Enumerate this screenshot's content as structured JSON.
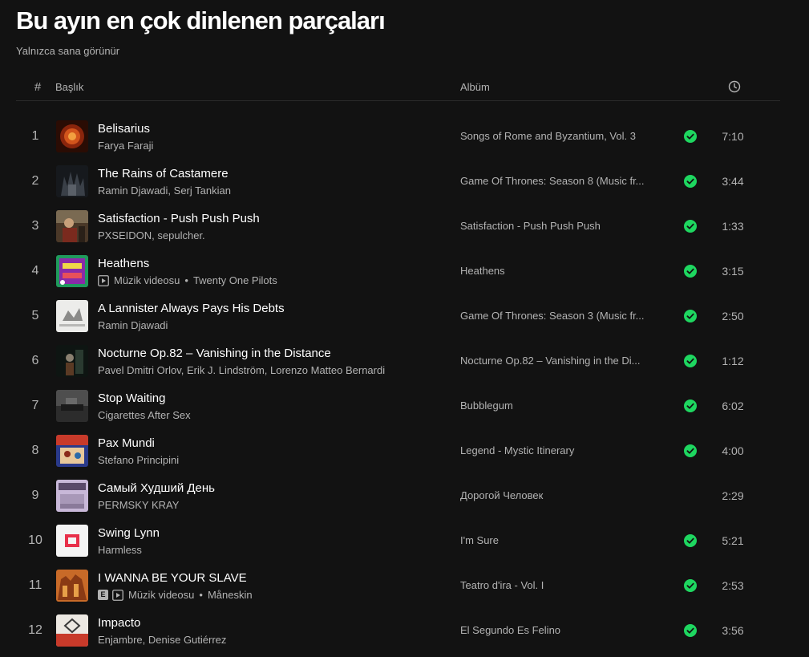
{
  "page": {
    "title": "Bu ayın en çok dinlenen parçaları",
    "subtitle": "Yalnızca sana görünür"
  },
  "header": {
    "num": "#",
    "title": "Başlık",
    "album": "Albüm",
    "duration_icon": "clock-icon"
  },
  "colors": {
    "accent": "#1ed760",
    "background": "#121212",
    "muted": "#b3b3b3"
  },
  "video_label": "Müzik videosu",
  "explicit_label": "E",
  "tracks": [
    {
      "num": "1",
      "title": "Belisarius",
      "artist": "Farya Faraji",
      "album": "Songs of Rome and Byzantium, Vol. 3",
      "duration": "7:10",
      "saved": true
    },
    {
      "num": "2",
      "title": "The Rains of Castamere",
      "artist": "Ramin Djawadi, Serj Tankian",
      "album": "Game Of Thrones: Season 8 (Music fr...",
      "duration": "3:44",
      "saved": true
    },
    {
      "num": "3",
      "title": "Satisfaction - Push Push Push",
      "artist": "PXSEIDON, sepulcher.",
      "album": "Satisfaction - Push Push Push",
      "duration": "1:33",
      "saved": true
    },
    {
      "num": "4",
      "title": "Heathens",
      "artist": "Twenty One Pilots",
      "album": "Heathens",
      "duration": "3:15",
      "saved": true,
      "video": true
    },
    {
      "num": "5",
      "title": "A Lannister Always Pays His Debts",
      "artist": "Ramin Djawadi",
      "album": "Game Of Thrones: Season 3 (Music fr...",
      "duration": "2:50",
      "saved": true
    },
    {
      "num": "6",
      "title": "Nocturne Op.82 – Vanishing in the Distance",
      "artist": "Pavel Dmitri Orlov, Erik J. Lindström, Lorenzo Matteo Bernardi",
      "album": "Nocturne Op.82 – Vanishing in the Di...",
      "duration": "1:12",
      "saved": true
    },
    {
      "num": "7",
      "title": "Stop Waiting",
      "artist": "Cigarettes After Sex",
      "album": "Bubblegum",
      "duration": "6:02",
      "saved": true
    },
    {
      "num": "8",
      "title": "Pax Mundi",
      "artist": "Stefano Principini",
      "album": "Legend - Mystic Itinerary",
      "duration": "4:00",
      "saved": true
    },
    {
      "num": "9",
      "title": "Самый Худший День",
      "artist": "PERMSKY KRAY",
      "album": "Дорогой Человек",
      "duration": "2:29",
      "saved": false
    },
    {
      "num": "10",
      "title": "Swing Lynn",
      "artist": "Harmless",
      "album": "I'm Sure",
      "duration": "5:21",
      "saved": true
    },
    {
      "num": "11",
      "title": "I WANNA BE YOUR SLAVE",
      "artist": "Måneskin",
      "album": "Teatro d'ira - Vol. I",
      "duration": "2:53",
      "saved": true,
      "video": true,
      "explicit": true
    },
    {
      "num": "12",
      "title": "Impacto",
      "artist": "Enjambre, Denise Gutiérrez",
      "album": "El Segundo Es Felino",
      "duration": "3:56",
      "saved": true
    }
  ]
}
